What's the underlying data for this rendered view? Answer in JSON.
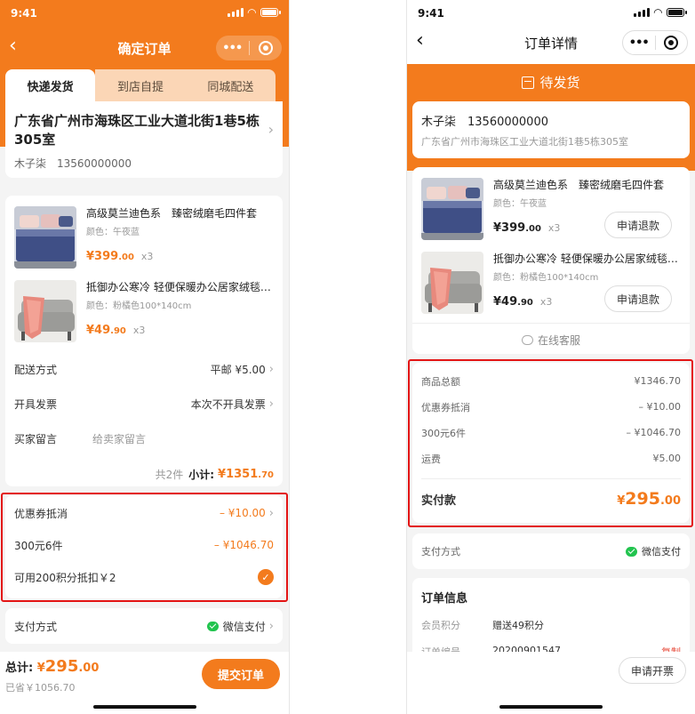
{
  "status_time": "9:41",
  "left": {
    "nav_title": "确定订单",
    "tabs": [
      {
        "label": "快递发货",
        "active": true
      },
      {
        "label": "到店自提",
        "active": false
      },
      {
        "label": "同城配送",
        "active": false
      }
    ],
    "address": {
      "text": "广东省广州市海珠区工业大道北街1巷5栋305室",
      "name_phone": "木子柒　13560000000"
    },
    "goods": [
      {
        "title": "高级莫兰迪色系　臻密绒磨毛四件套",
        "spec": "颜色：午夜蓝",
        "price_int": "399",
        "price_dec": ".00",
        "currency": "¥",
        "qty": "x3"
      },
      {
        "title": "抵御办公寒冷 轻便保暖办公居家绒毯…",
        "spec": "颜色：粉橘色100*140cm",
        "price_int": "49",
        "price_dec": ".90",
        "currency": "¥",
        "qty": "x3"
      }
    ],
    "shipping": {
      "label": "配送方式",
      "value": "平邮 ¥5.00"
    },
    "invoice": {
      "label": "开具发票",
      "value": "本次不开具发票"
    },
    "message": {
      "label": "买家留言",
      "placeholder": "给卖家留言"
    },
    "summary": {
      "count": "共2件",
      "subtotal_label": "小计:",
      "currency": "¥",
      "subtotal_int": "1351",
      "subtotal_dec": ".70"
    },
    "discounts": [
      {
        "label": "优惠券抵消",
        "value": "– ¥10.00"
      },
      {
        "label": "300元6件",
        "value": "– ¥1046.70"
      },
      {
        "label": "可用200积分抵扣￥2",
        "value": ""
      }
    ],
    "payment": {
      "label": "支付方式",
      "value": "微信支付"
    },
    "total": {
      "label": "总计:",
      "currency": "¥",
      "int": "295",
      "dec": ".00",
      "saved": "已省￥1056.70"
    },
    "submit_label": "提交订单"
  },
  "right": {
    "nav_title": "订单详情",
    "status": "待发货",
    "receiver": {
      "name_phone": "木子柒　13560000000",
      "address": "广东省广州市海珠区工业大道北街1巷5栋305室"
    },
    "goods": [
      {
        "title": "高级莫兰迪色系　臻密绒磨毛四件套",
        "spec": "颜色：午夜蓝",
        "price_int": "399",
        "price_dec": ".00",
        "currency": "¥",
        "qty": "x3",
        "action": "申请退款"
      },
      {
        "title": "抵御办公寒冷 轻便保暖办公居家绒毯…",
        "spec": "颜色：粉橘色100*140cm",
        "price_int": "49",
        "price_dec": ".90",
        "currency": "¥",
        "qty": "x3",
        "action": "申请退款"
      }
    ],
    "service_label": "在线客服",
    "costs": [
      {
        "label": "商品总额",
        "value": "¥1346.70"
      },
      {
        "label": "优惠券抵消",
        "value": "– ¥10.00"
      },
      {
        "label": "300元6件",
        "value": "– ¥1046.70"
      },
      {
        "label": "运费",
        "value": "¥5.00"
      }
    ],
    "paid": {
      "label": "实付款",
      "currency": "¥",
      "int": "295",
      "dec": ".00"
    },
    "payment": {
      "label": "支付方式",
      "value": "微信支付"
    },
    "order_info": {
      "title": "订单信息",
      "points_label": "会员积分",
      "points_value": "赠送49积分",
      "order_no_label": "订单编号",
      "order_no_value": "20200901547",
      "copy_label": "复制"
    },
    "invoice_button": "申请开票"
  }
}
